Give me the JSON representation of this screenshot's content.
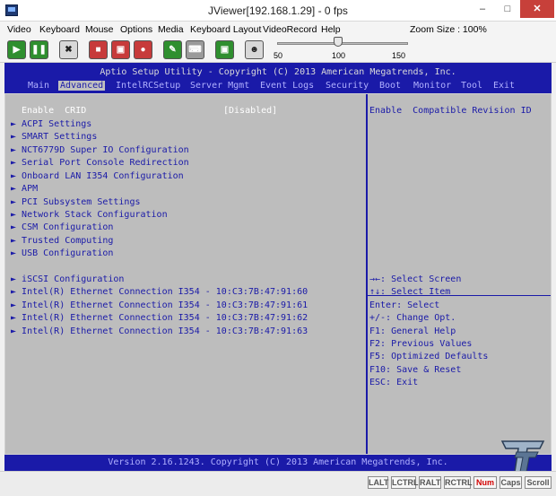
{
  "window": {
    "title": "JViewer[192.168.1.29] - 0 fps"
  },
  "menu": [
    "Video",
    "Keyboard",
    "Mouse",
    "Options",
    "Media",
    "Keyboard Layout",
    "VideoRecord",
    "Help"
  ],
  "zoom": {
    "label": "Zoom Size : 100%",
    "value": 100,
    "ticks": [
      "50",
      "100",
      "150"
    ]
  },
  "toolbar_icons": [
    "play-icon",
    "pause-icon",
    "fullscreen-icon",
    "stop-icon",
    "save-icon",
    "record-icon",
    "mouse-icon",
    "keyboard-icon",
    "screenshot-icon",
    "users-icon"
  ],
  "bios": {
    "title": "Aptio Setup Utility - Copyright (C) 2013 American Megatrends, Inc.",
    "tabs": [
      "Main",
      "Advanced",
      "IntelRCSetup",
      "Server Mgmt",
      "Event Logs",
      "Security",
      "Boot",
      "Monitor",
      "Tool",
      "Exit"
    ],
    "active_tab": "Advanced",
    "crid": {
      "label": "Enable  CRID",
      "value": "[Disabled]"
    },
    "items": [
      "ACPI Settings",
      "SMART Settings",
      "NCT6779D Super IO Configuration",
      "Serial Port Console Redirection",
      "Onboard LAN I354 Configuration",
      "APM",
      "PCI Subsystem Settings",
      "Network Stack Configuration",
      "CSM Configuration",
      "Trusted Computing",
      "USB Configuration"
    ],
    "items2": [
      "iSCSI Configuration",
      "Intel(R) Ethernet Connection I354 - 10:C3:7B:47:91:60",
      "Intel(R) Ethernet Connection I354 - 10:C3:7B:47:91:61",
      "Intel(R) Ethernet Connection I354 - 10:C3:7B:47:91:62",
      "Intel(R) Ethernet Connection I354 - 10:C3:7B:47:91:63"
    ],
    "help_text": "Enable  Compatible Revision ID",
    "keys": [
      "→←: Select Screen",
      "↑↓: Select Item",
      "Enter: Select",
      "+/-: Change Opt.",
      "F1: General Help",
      "F2: Previous Values",
      "F5: Optimized Defaults",
      "F10: Save & Reset",
      "ESC: Exit"
    ],
    "footer": "Version 2.16.1243. Copyright (C) 2013 American Megatrends, Inc."
  },
  "status_keys": [
    {
      "label": "LALT",
      "on": false
    },
    {
      "label": "LCTRL",
      "on": false
    },
    {
      "label": "RALT",
      "on": false
    },
    {
      "label": "RCTRL",
      "on": false
    },
    {
      "label": "Num",
      "on": true
    },
    {
      "label": "Caps",
      "on": false
    },
    {
      "label": "Scroll",
      "on": false
    }
  ]
}
